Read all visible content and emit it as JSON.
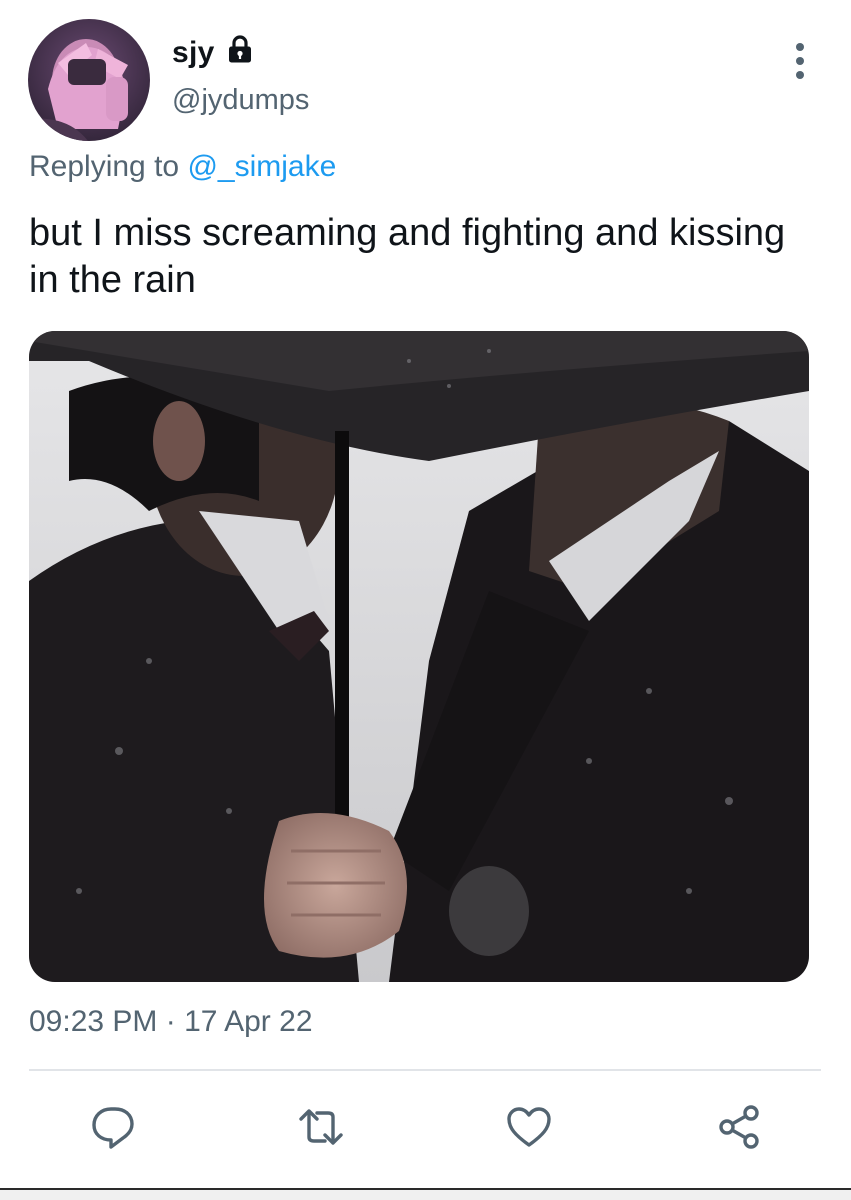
{
  "author": {
    "display_name": "sjy",
    "handle": "@jydumps",
    "protected": true,
    "avatar_icon": "avatar-photo"
  },
  "reply": {
    "prefix": "Replying to",
    "mention": "@_simjake"
  },
  "tweet": {
    "text": "but I miss screaming and fighting and kissing in the rain",
    "timestamp": "09:23 PM · 17 Apr 22",
    "media_icon": "photo-two-people-under-umbrella"
  },
  "actions": {
    "reply_icon": "reply-icon",
    "retweet_icon": "retweet-icon",
    "like_icon": "heart-icon",
    "share_icon": "share-icon"
  },
  "colors": {
    "text_primary": "#0f1419",
    "text_secondary": "#536471",
    "link": "#1d9bf0",
    "icon": "#536471"
  }
}
